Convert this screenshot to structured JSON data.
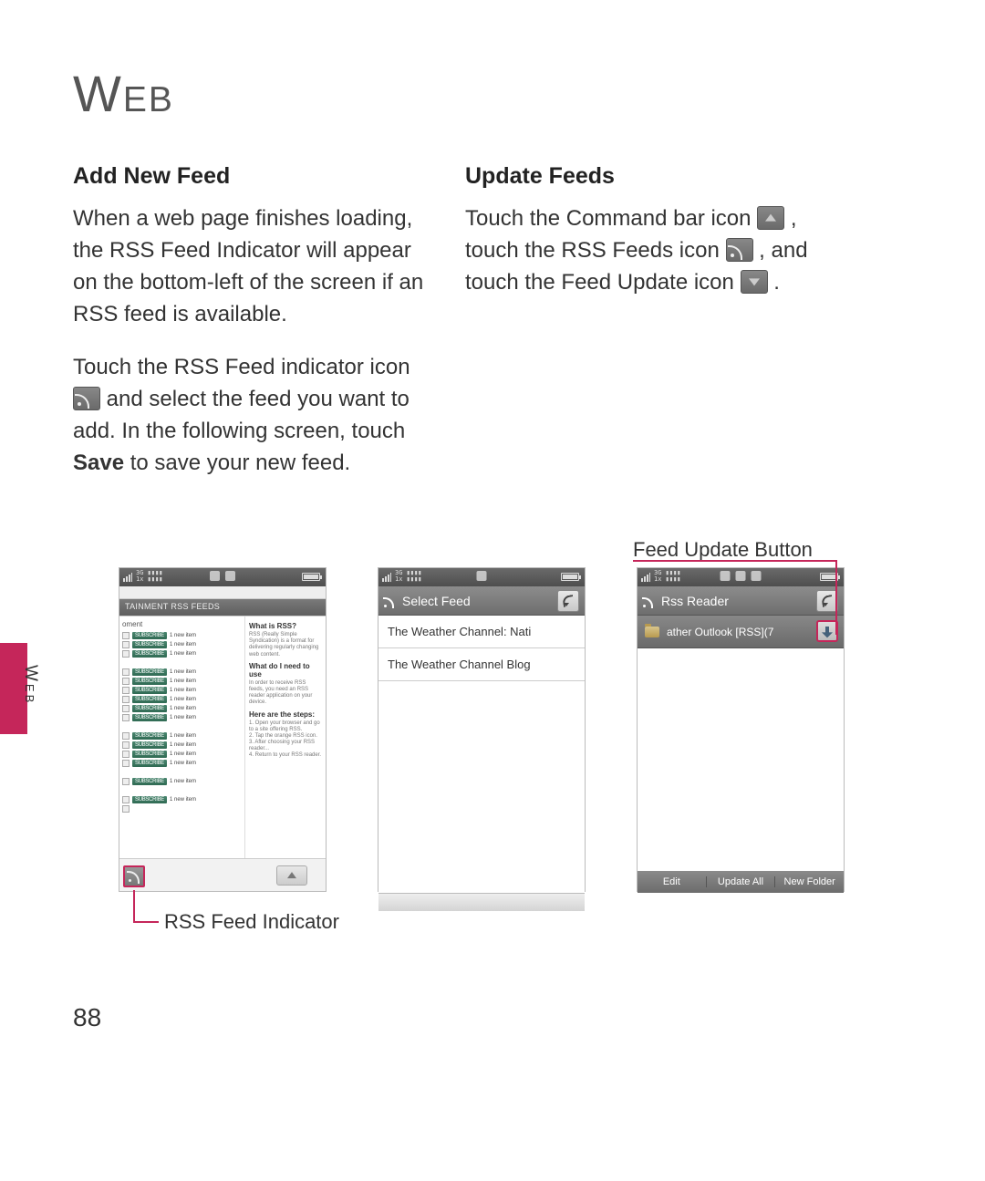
{
  "title": "Web",
  "sidetab": "Web",
  "page_number": "88",
  "left": {
    "heading": "Add New Feed",
    "p1": "When a web page finishes loading, the RSS Feed Indicator will appear on the bottom-left of the screen if an RSS feed is available.",
    "p2a": "Touch the RSS Feed indicator icon ",
    "p2b": " and select the feed you want to add. In the following screen, touch ",
    "save": "Save",
    "p2c": " to save your new feed."
  },
  "right": {
    "heading": "Update Feeds",
    "p1a": "Touch the Command bar icon ",
    "p1b": ", touch the RSS Feeds icon ",
    "p1c": ", and touch the Feed Update icon ",
    "p1d": "."
  },
  "callouts": {
    "rss_indicator": "RSS Feed Indicator",
    "feed_update": "Feed Update Button"
  },
  "shot1": {
    "status_text": "3G ▮▮▮▮\n1x ▮▮▮▮",
    "tab_label": "TAINMENT RSS FEEDS",
    "category": "oment",
    "chip": "SUBSCRIBE",
    "count": "1 new item",
    "rp_h1": "What is RSS?",
    "rp_b1": "RSS (Really Simple Syndication) is a format for delivering regularly changing web content.",
    "rp_h2": "What do I need to use",
    "rp_b2": "In order to receive RSS feeds, you need an RSS reader application on your device.",
    "rp_h3": "Here are the steps:",
    "rp_b3": "1. Open your browser and go to a site offering RSS.\n2. Tap the orange RSS icon.\n3. After choosing your RSS reader...\n4. Return to your RSS reader."
  },
  "shot2": {
    "title": "Select Feed",
    "item1": "The Weather Channel:  Nati",
    "item2": "The Weather Channel Blog"
  },
  "shot3": {
    "title": "Rss Reader",
    "folder_label": "ather Outlook [RSS](7",
    "foot1": "Edit",
    "foot2": "Update All",
    "foot3": "New Folder"
  }
}
